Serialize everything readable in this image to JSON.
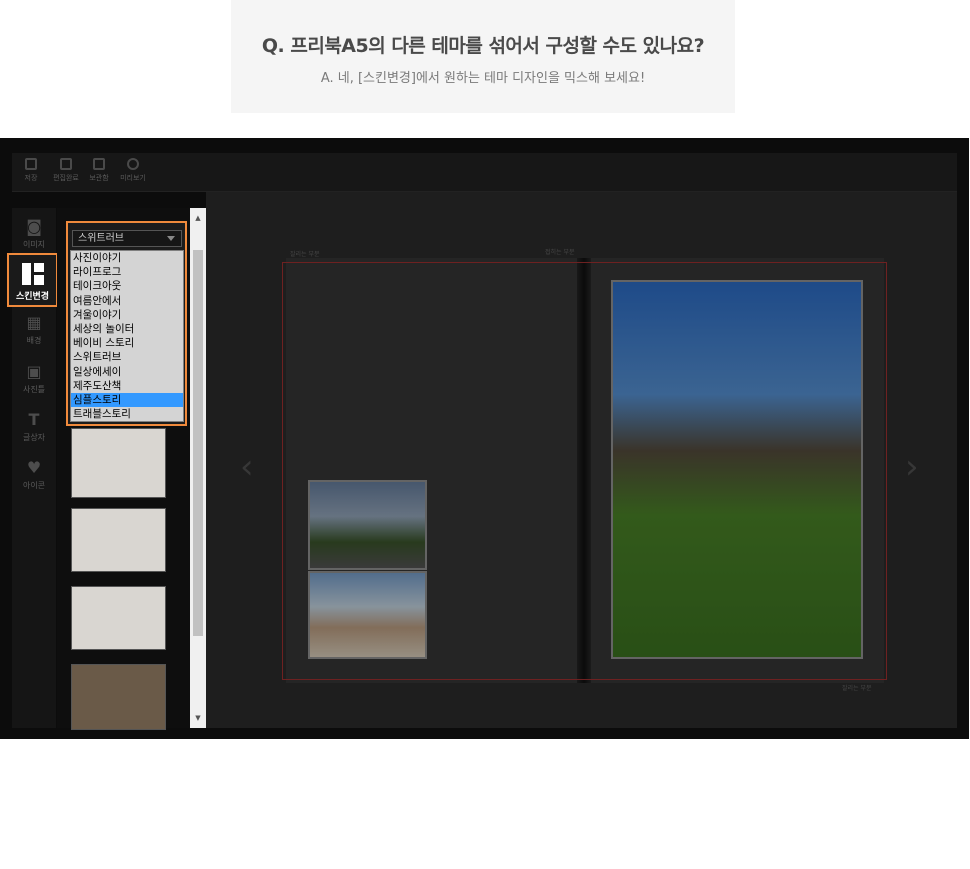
{
  "faq": {
    "question": "Q. 프리북A5의 다른 테마를  섞어서 구성할 수도 있나요?",
    "answer": "A. 네, [스킨변경]에서 원하는 테마 디자인을 믹스해 보세요!"
  },
  "toolbar": {
    "items": [
      {
        "label": "저장",
        "icon": "save-icon"
      },
      {
        "label": "편집완료",
        "icon": "edit-done-icon"
      },
      {
        "label": "보관함",
        "icon": "storage-icon"
      },
      {
        "label": "미리보기",
        "icon": "preview-icon"
      }
    ]
  },
  "left_nav": {
    "items": [
      {
        "label": "이미지",
        "icon": "camera-icon"
      },
      {
        "label": "스킨변경",
        "icon": "layout-icon",
        "active": true
      },
      {
        "label": "배경",
        "icon": "grid-icon"
      },
      {
        "label": "사진틀",
        "icon": "picture-icon"
      },
      {
        "label": "글상자",
        "icon": "text-icon"
      },
      {
        "label": "아이콘",
        "icon": "heart-icon"
      }
    ]
  },
  "skin_select": {
    "selected": "스위트러브",
    "options": [
      "사진이야기",
      "라이프로그",
      "테이크아웃",
      "여름안에서",
      "겨울이야기",
      "세상의 놀이터",
      "베이비 스토리",
      "스위트러브",
      "일상에세이",
      "제주도산책",
      "심플스토리",
      "트래블스토리"
    ],
    "highlighted": "심플스토리"
  },
  "canvas": {
    "guides": {
      "cut_top_left": "잘리는 부분",
      "cut_top_center": "접히는 부분",
      "cut_bottom_right": "잘리는 부분"
    }
  },
  "colors": {
    "accent_outline": "#f08a3c",
    "selection_blue": "#3399ff",
    "cut_line_red": "#aa3333"
  }
}
